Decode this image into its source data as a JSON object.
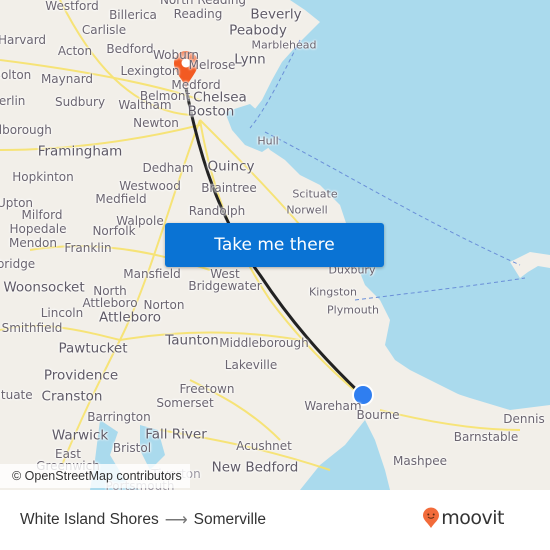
{
  "map": {
    "colors": {
      "land": "#f2efe9",
      "water": "#aadaed",
      "roads": "#f7e26b",
      "route_line": "#222222",
      "destination_pin": "#f25a22",
      "origin_marker": "#2f7ef0",
      "ferry_line": "#6a8fd8"
    },
    "places": [
      {
        "name": "Westford"
      },
      {
        "name": "North Reading"
      },
      {
        "name": "Billerica"
      },
      {
        "name": "Reading"
      },
      {
        "name": "Beverly"
      },
      {
        "name": "Harvard"
      },
      {
        "name": "Carlisle"
      },
      {
        "name": "Peabody"
      },
      {
        "name": "Acton"
      },
      {
        "name": "Bedford"
      },
      {
        "name": "Woburn"
      },
      {
        "name": "Marblehead"
      },
      {
        "name": "Bolton"
      },
      {
        "name": "Maynard"
      },
      {
        "name": "Lexington"
      },
      {
        "name": "Melrose"
      },
      {
        "name": "Lynn"
      },
      {
        "name": "Medford"
      },
      {
        "name": "Berlin"
      },
      {
        "name": "Sudbury"
      },
      {
        "name": "Waltham"
      },
      {
        "name": "Belmont"
      },
      {
        "name": "Chelsea"
      },
      {
        "name": "Boston"
      },
      {
        "name": "Marlborough"
      },
      {
        "name": "Newton"
      },
      {
        "name": "Hull"
      },
      {
        "name": "Framingham"
      },
      {
        "name": "Dedham"
      },
      {
        "name": "Quincy"
      },
      {
        "name": "Hopkinton"
      },
      {
        "name": "Westwood"
      },
      {
        "name": "Braintree"
      },
      {
        "name": "Scituate"
      },
      {
        "name": "Upton"
      },
      {
        "name": "Medfield"
      },
      {
        "name": "Milford"
      },
      {
        "name": "Walpole"
      },
      {
        "name": "Randolph"
      },
      {
        "name": "Norwell"
      },
      {
        "name": "Hopedale"
      },
      {
        "name": "Norfolk"
      },
      {
        "name": "Mendon"
      },
      {
        "name": "Franklin"
      },
      {
        "name": "Uxbridge"
      },
      {
        "name": "Mansfield"
      },
      {
        "name": "West Bridgewater"
      },
      {
        "name": "Duxbury"
      },
      {
        "name": "Woonsocket"
      },
      {
        "name": "North Attleboro"
      },
      {
        "name": "Norton"
      },
      {
        "name": "Kingston"
      },
      {
        "name": "Lincoln"
      },
      {
        "name": "Attleboro"
      },
      {
        "name": "Plymouth"
      },
      {
        "name": "Smithfield"
      },
      {
        "name": "Pawtucket"
      },
      {
        "name": "Taunton"
      },
      {
        "name": "Middleborough"
      },
      {
        "name": "Lakeville"
      },
      {
        "name": "Providence"
      },
      {
        "name": "Scituate"
      },
      {
        "name": "Cranston"
      },
      {
        "name": "Freetown"
      },
      {
        "name": "Somerset"
      },
      {
        "name": "Wareham"
      },
      {
        "name": "Bourne"
      },
      {
        "name": "Barrington"
      },
      {
        "name": "Dennis"
      },
      {
        "name": "Warwick"
      },
      {
        "name": "Fall River"
      },
      {
        "name": "Barnstable"
      },
      {
        "name": "Bristol"
      },
      {
        "name": "East Greenwich"
      },
      {
        "name": "Acushnet"
      },
      {
        "name": "Mashpee"
      },
      {
        "name": "New Bedford"
      },
      {
        "name": "Tiverton"
      },
      {
        "name": "Portsmouth"
      }
    ],
    "origin": {
      "name": "White Island Shores",
      "icon": "origin-dot-icon"
    },
    "destination": {
      "name": "Somerville",
      "icon": "map-pin-icon"
    },
    "cta_label": "Take me there",
    "attribution": "© OpenStreetMap contributors"
  },
  "footer": {
    "origin": "White Island Shores",
    "arrow": "⟶",
    "destination": "Somerville",
    "brand": "moovit"
  }
}
